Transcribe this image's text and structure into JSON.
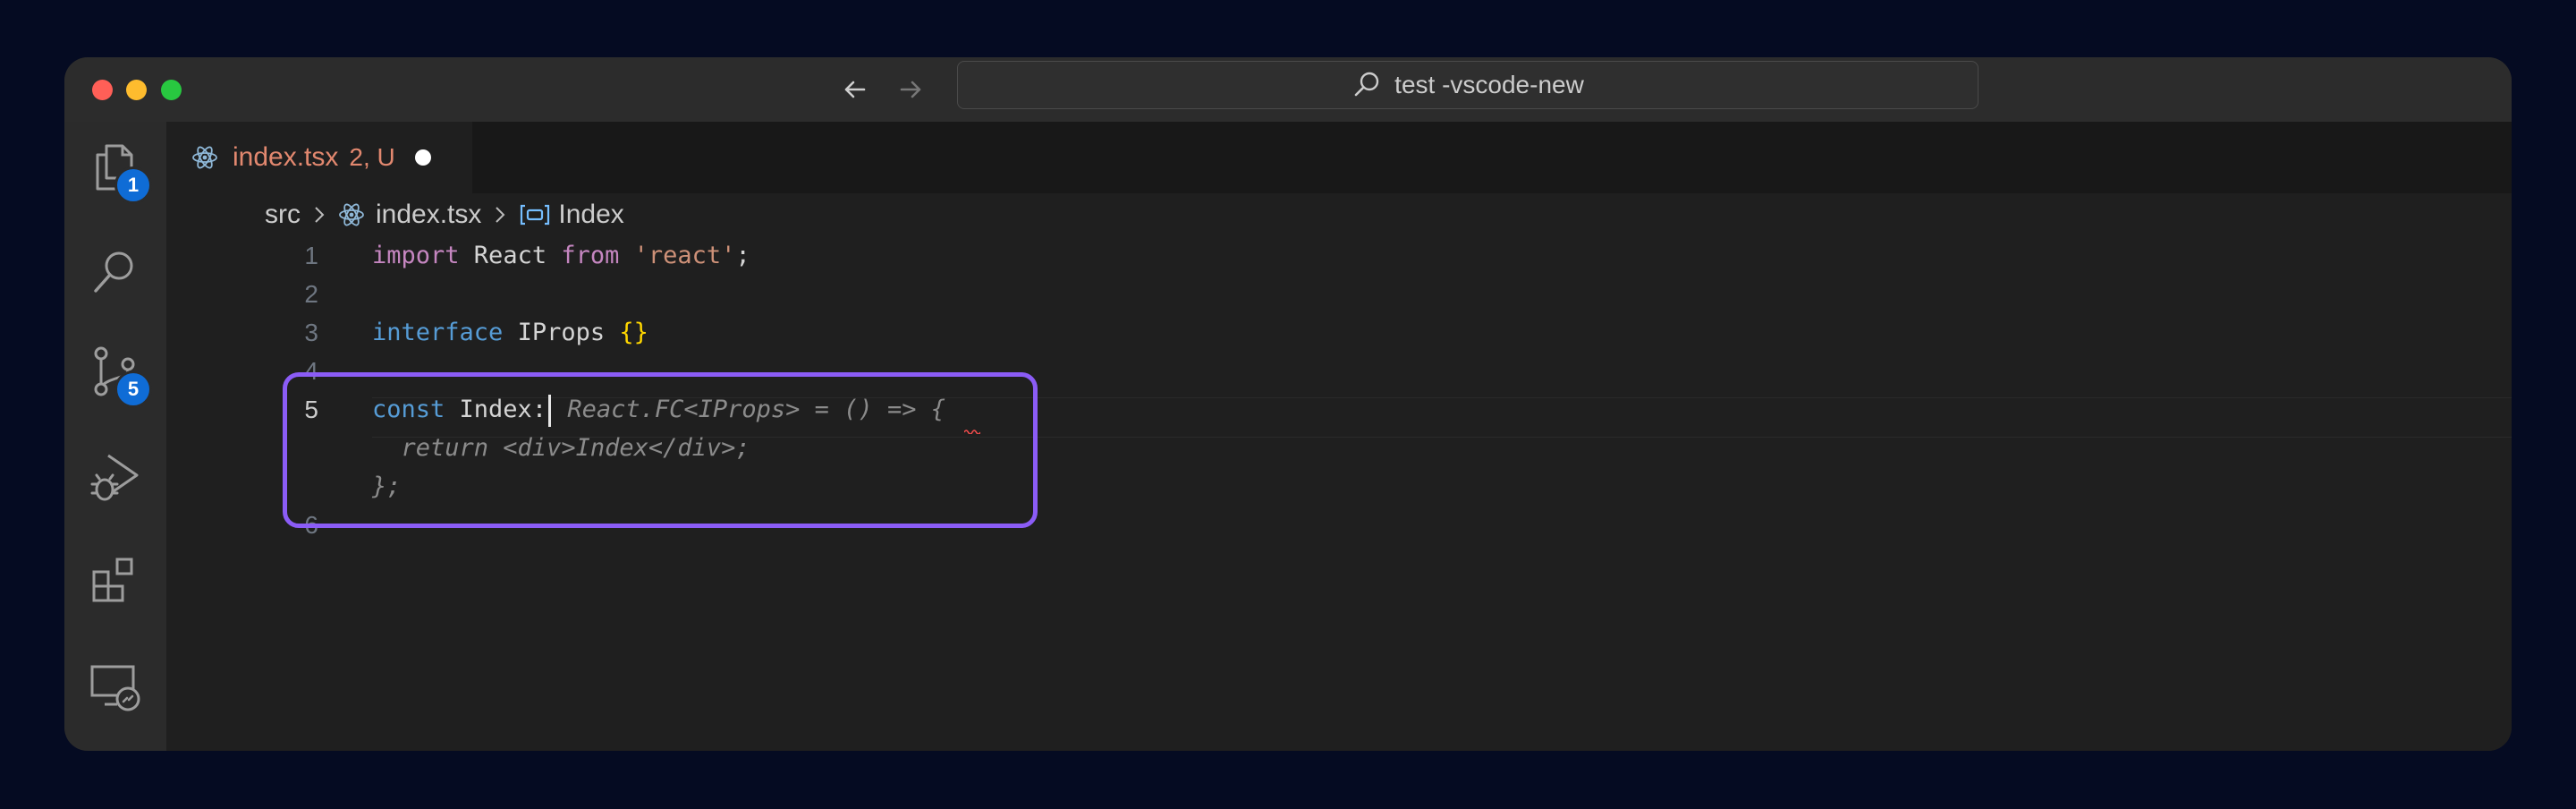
{
  "titlebar": {
    "search_text": "test -vscode-new",
    "icons": {
      "back": "arrow-left-icon",
      "forward": "arrow-right-icon",
      "search": "search-icon"
    }
  },
  "activitybar": {
    "explorer_badge": "1",
    "source_control_badge": "5",
    "icons": [
      "files-icon",
      "search-icon",
      "source-control-icon",
      "run-debug-icon",
      "extensions-icon",
      "remote-explorer-icon"
    ]
  },
  "tab": {
    "filename": "index.tsx",
    "status": "2, U",
    "icon": "react-icon"
  },
  "breadcrumb": {
    "folder": "src",
    "file": "index.tsx",
    "symbol": "Index"
  },
  "code": {
    "line_numbers": [
      "1",
      "2",
      "3",
      "4",
      "5",
      "6"
    ],
    "line1": {
      "kw": "import",
      "ident": " React ",
      "kw2": "from",
      "str": "'react'",
      "end": ";"
    },
    "line3": {
      "kw": "interface",
      "ident": " IProps ",
      "brace": "{}"
    },
    "line5": {
      "kw": "const",
      "ident": " Index:",
      "ghost": " React.FC<IProps> = () => {"
    },
    "ghost_line2": "  return <div>Index</div>;",
    "ghost_line3": "};"
  },
  "colors": {
    "accent_highlight": "#8b5cf6",
    "tab_modified": "#e2886f",
    "badge": "#0f6cd6"
  }
}
